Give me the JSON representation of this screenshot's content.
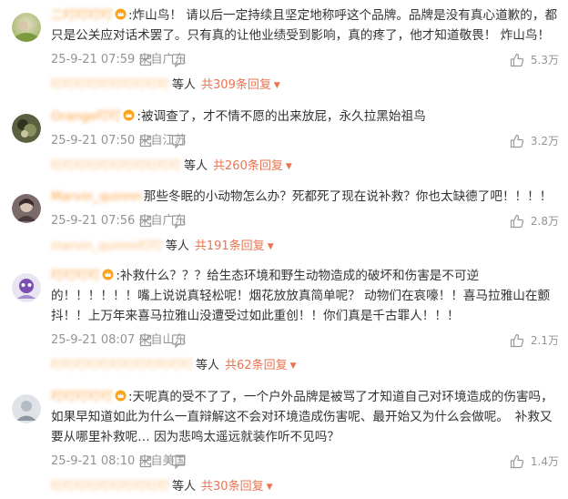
{
  "comments": [
    {
      "username": "二叮叮叮叮",
      "text": ":炸山鸟！ 请以后一定持续且坚定地称呼这个品牌。品牌是没有真心道歉的，都只是公关应对话术罢了。只有真的让他业绩受到影响，真的疼了，他才知道敬畏！ 炸山鸟！",
      "time": "25-9-21 07:59 来自广东",
      "likes": "5.3万",
      "reply_names": "叮叮叮叮叮叮叮叮叮叮",
      "reply_suffix": "等人",
      "reply_more": "共309条回复"
    },
    {
      "username": "Orange叮叮",
      "text": ":被调查了，才不情不愿的出来放屁，永久拉黑始祖鸟",
      "time": "25-9-21 07:50 来自江苏",
      "likes": "3.2万",
      "reply_names": "叮叮叮叮叮叮叮叮叮叮叮",
      "reply_suffix": "等人",
      "reply_more": "共260条回复"
    },
    {
      "username": "Marvin_quinnn",
      "text": "那些冬眠的小动物怎么办？死都死了现在说补救？你也太缺德了吧！！！！",
      "time": "25-9-21 07:56 来自广东",
      "likes": "2.8万",
      "reply_names": "marvin_quinnn叮叮",
      "reply_suffix": "等人",
      "reply_more": "共191条回复"
    },
    {
      "username": "叮叮叮叮",
      "text": ":补救什么？？？给生态环境和野生动物造成的破坏和伤害是不可逆的！！！！！！嘴上说说真轻松呢！烟花放放真简单呢？ 动物们在哀嚎！！喜马拉雅山在颤抖！！上万年来喜马拉雅山没遭受过如此重创！！你们真是千古罪人！！！",
      "time": "25-9-21 08:07 来自山东",
      "likes": "2.1万",
      "reply_names": "叮叮叮叮叮叮叮叮叮叮叮叮",
      "reply_suffix": "等人",
      "reply_more": "共62条回复"
    },
    {
      "username": "叮叮叮叮叮",
      "text": ":天呢真的受不了了，一个户外品牌是被骂了才知道自己对环境造成的伤害吗，如果早知道如此为什么一直辩解这不会对环境造成伤害呢、最开始又为什么会做呢。　补救又要从哪里补救呢… 因为悲鸣太遥远就装作听不见吗？",
      "time": "25-9-21 08:10 来自美国",
      "likes": "1.4万",
      "reply_names": "叮叮叮叮叮叮叮叮叮叮",
      "reply_suffix": "等人",
      "reply_more": "共30条回复"
    }
  ],
  "colors": {
    "username": "#ff8200",
    "reply_link": "#eb7350",
    "meta": "#939393"
  },
  "icons": {
    "share": "share-icon",
    "comment": "comment-icon",
    "like": "like-icon",
    "badge": "vip-crown-icon"
  }
}
